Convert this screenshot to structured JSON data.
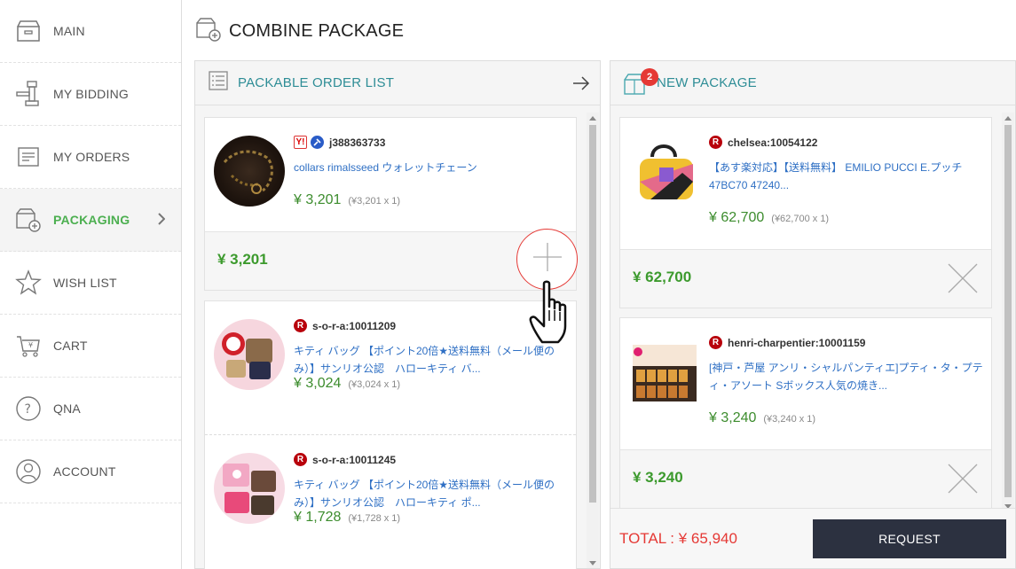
{
  "page": {
    "title": "COMBINE PACKAGE"
  },
  "sidebar": {
    "items": [
      {
        "label": "MAIN",
        "icon": "box-icon"
      },
      {
        "label": "MY BIDDING",
        "icon": "gavel-icon"
      },
      {
        "label": "MY ORDERS",
        "icon": "orders-icon"
      },
      {
        "label": "PACKAGING",
        "icon": "package-add-icon",
        "active": true
      },
      {
        "label": "WISH LIST",
        "icon": "star-icon"
      },
      {
        "label": "CART",
        "icon": "cart-icon"
      },
      {
        "label": "QNA",
        "icon": "question-icon"
      },
      {
        "label": "ACCOUNT",
        "icon": "user-icon"
      }
    ]
  },
  "left_panel": {
    "title": "PACKABLE ORDER LIST",
    "groups": [
      {
        "items": [
          {
            "seller": "j388363733",
            "name": "collars rimalsseed ウォレットチェーン",
            "price": "¥ 3,201",
            "qty": "(¥3,201 x 1)"
          }
        ],
        "total": "¥ 3,201"
      }
    ],
    "items": [
      {
        "seller": "s-o-r-a:10011209",
        "name": "キティ バッグ 【ポイント20倍★送料無料（メール便のみ）】サンリオ公認　ハローキティ バ...",
        "price": "¥ 3,024",
        "qty": "(¥3,024 x 1)"
      },
      {
        "seller": "s-o-r-a:10011245",
        "name": "キティ バッグ 【ポイント20倍★送料無料（メール便のみ）】サンリオ公認　ハローキティ ポ...",
        "price": "¥ 1,728",
        "qty": "(¥1,728 x 1)"
      }
    ]
  },
  "right_panel": {
    "title": "NEW PACKAGE",
    "count": "2",
    "packages": [
      {
        "seller": "chelsea:10054122",
        "name": "【あす楽対応】【送料無料】 EMILIO PUCCI E.プッチ 47BC70 47240...",
        "price": "¥ 62,700",
        "qty": "(¥62,700 x 1)",
        "total": "¥ 62,700"
      },
      {
        "seller": "henri-charpentier:10001159",
        "name": "[神戸・芦屋 アンリ・シャルパンティエ]プティ・タ・プティ・アソート Sボックス人気の焼き...",
        "price": "¥ 3,240",
        "qty": "(¥3,240 x 1)",
        "total": "¥ 3,240"
      }
    ],
    "total_label": "TOTAL : ¥ 65,940",
    "request_label": "REQUEST"
  },
  "colors": {
    "accent": "#2e8d96",
    "price": "#3c8c2d",
    "total": "#e53935",
    "active": "#4caf50",
    "button": "#2c3140"
  }
}
